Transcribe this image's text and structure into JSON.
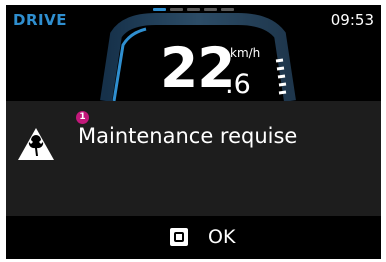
{
  "status_bar": {
    "mode": "DRIVE",
    "time": "09:53",
    "mode_color": "#2f8fd0"
  },
  "pager": {
    "pages": 5,
    "active_index": 0
  },
  "speedometer": {
    "speed_integer": "22",
    "speed_decimal": ".6",
    "unit": "km/h"
  },
  "alert": {
    "badge": "1",
    "message": "Maintenance requise",
    "icon": "wrench-warning-icon",
    "badge_color": "#c2187a",
    "panel_color": "#1d1d1d"
  },
  "action": {
    "label": "OK",
    "icon": "square-button-icon"
  }
}
